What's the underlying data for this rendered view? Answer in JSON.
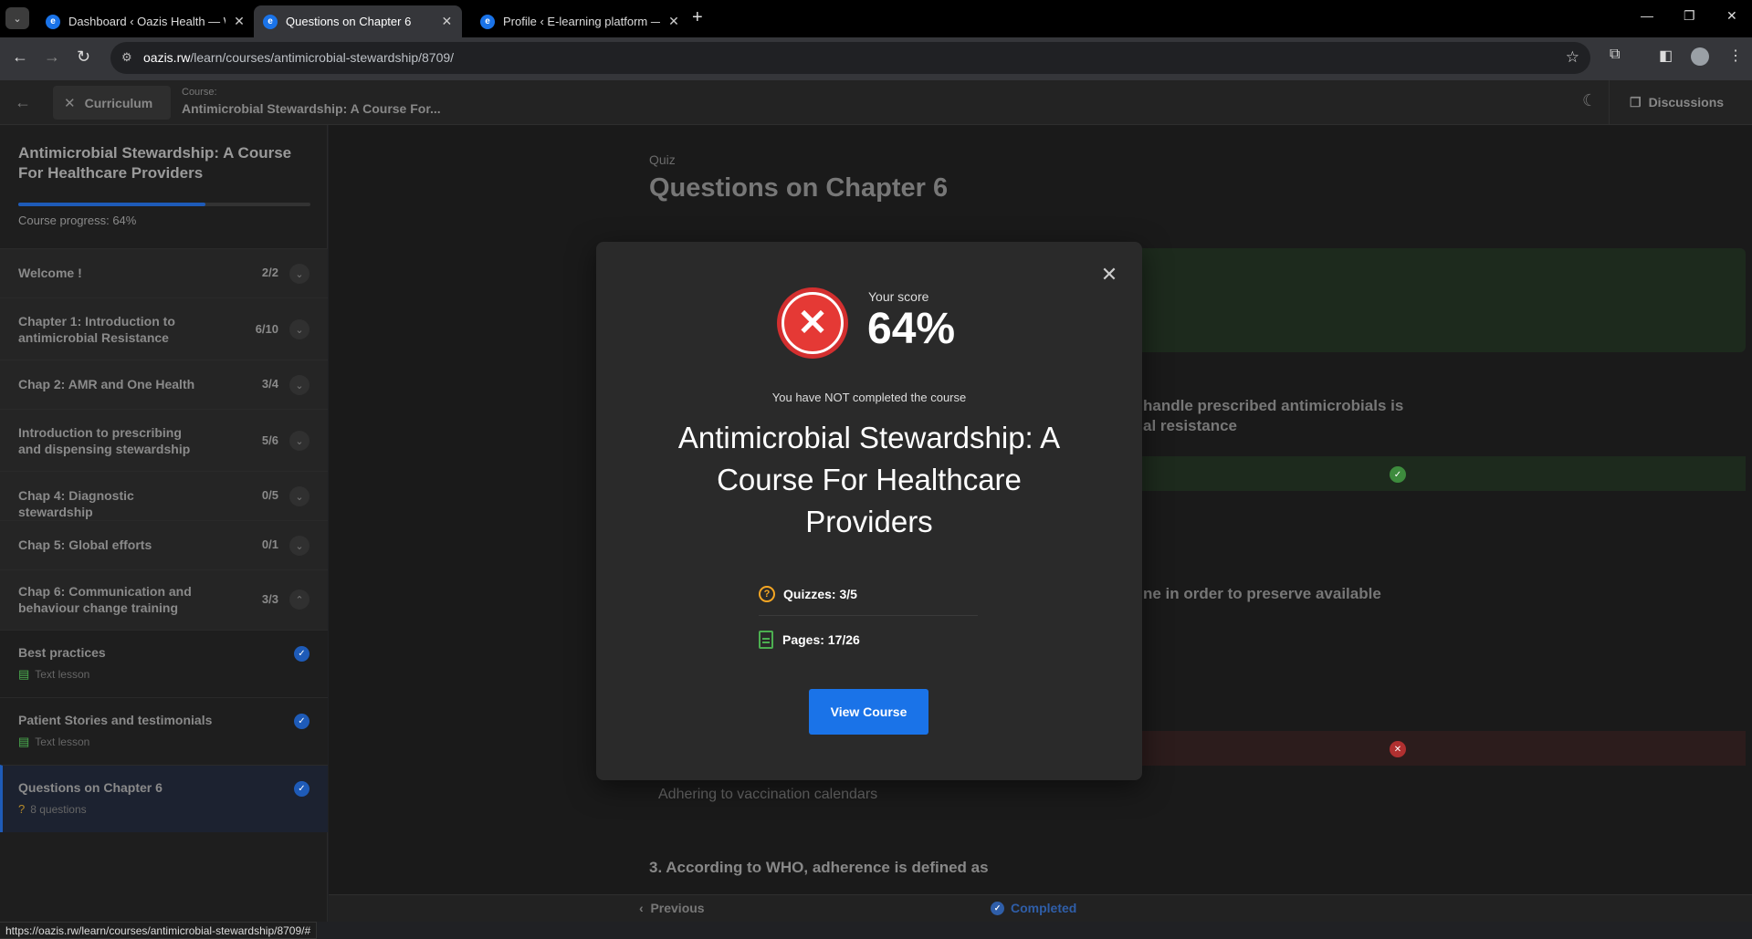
{
  "browser": {
    "tabs": [
      {
        "title": "Dashboard ‹ Oazis Health — W"
      },
      {
        "title": "Questions on Chapter 6"
      },
      {
        "title": "Profile ‹ E-learning platform —"
      }
    ],
    "url_domain": "oazis.rw",
    "url_path": "/learn/courses/antimicrobial-stewardship/8709/",
    "status_url": "https://oazis.rw/learn/courses/antimicrobial-stewardship/8709/#"
  },
  "appbar": {
    "curriculum_label": "Curriculum",
    "course_label": "Course:",
    "course_name": "Antimicrobial Stewardship: A Course For...",
    "discussions_label": "Discussions"
  },
  "sidebar": {
    "course_title": "Antimicrobial Stewardship: A Course For Healthcare Providers",
    "progress_fraction": 0.64,
    "progress_text": "Course progress: 64%",
    "sections": [
      {
        "label": "Welcome !",
        "count": "2/2"
      },
      {
        "label": "Chapter 1: Introduction to antimicrobial Resistance",
        "count": "6/10"
      },
      {
        "label": "Chap 2: AMR and One Health",
        "count": "3/4"
      },
      {
        "label": "Introduction to prescribing and dispensing stewardship",
        "count": "5/6"
      },
      {
        "label": "Chap 4: Diagnostic stewardship",
        "count": "0/5"
      },
      {
        "label": "Chap 5: Global efforts",
        "count": "0/1"
      },
      {
        "label": "Chap 6: Communication and behaviour change training",
        "count": "3/3"
      }
    ],
    "lessons": [
      {
        "label": "Best practices",
        "sub": "Text lesson"
      },
      {
        "label": "Patient Stories and testimonials",
        "sub": "Text lesson"
      },
      {
        "label": "Questions on Chapter 6",
        "sub": "8 questions"
      }
    ]
  },
  "main": {
    "kicker": "Quiz",
    "title": "Questions on Chapter 6",
    "bg_q1_line1": "handle prescribed antimicrobials is",
    "bg_q1_line2": "al resistance",
    "bg_q2_line": "ne in order to preserve available",
    "bg_option": "Adhering to vaccination calendars",
    "bg_q3": "3. According to WHO, adherence is defined as"
  },
  "footer": {
    "previous_label": "Previous",
    "completed_label": "Completed"
  },
  "modal": {
    "score_label": "Your score",
    "score_value": "64%",
    "status_text": "You have NOT completed the course",
    "course_title": "Antimicrobial Stewardship: A Course For Healthcare Providers",
    "quizzes_text": "Quizzes: 3/5",
    "pages_text": "Pages: 17/26",
    "button_label": "View Course"
  }
}
